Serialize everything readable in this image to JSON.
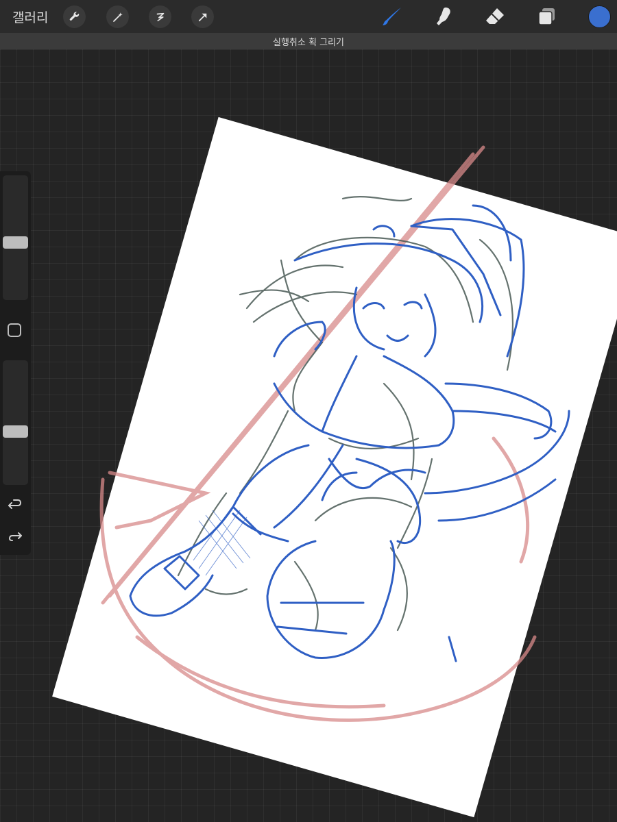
{
  "toolbar": {
    "gallery_label": "갤러리",
    "left_tools": [
      "wrench-icon",
      "magic-wand-icon",
      "selection-icon",
      "transform-arrow-icon"
    ],
    "right_tools": [
      "brush-icon",
      "smudge-icon",
      "eraser-icon",
      "layers-icon"
    ],
    "active_tool": "brush-icon",
    "current_color": "#3a6fcf"
  },
  "status": {
    "text": "실행취소 획 그리기"
  },
  "sidebar": {
    "brush_size_level": 0.46,
    "opacity_level": 0.42,
    "modify_button": "square-icon",
    "undo": "undo-icon",
    "redo": "redo-icon"
  },
  "colors": {
    "sketch_blue": "#2f5fc4",
    "sketch_gray": "#4a5a55",
    "sketch_red": "#d88a8a",
    "accent": "#2f78e8"
  }
}
